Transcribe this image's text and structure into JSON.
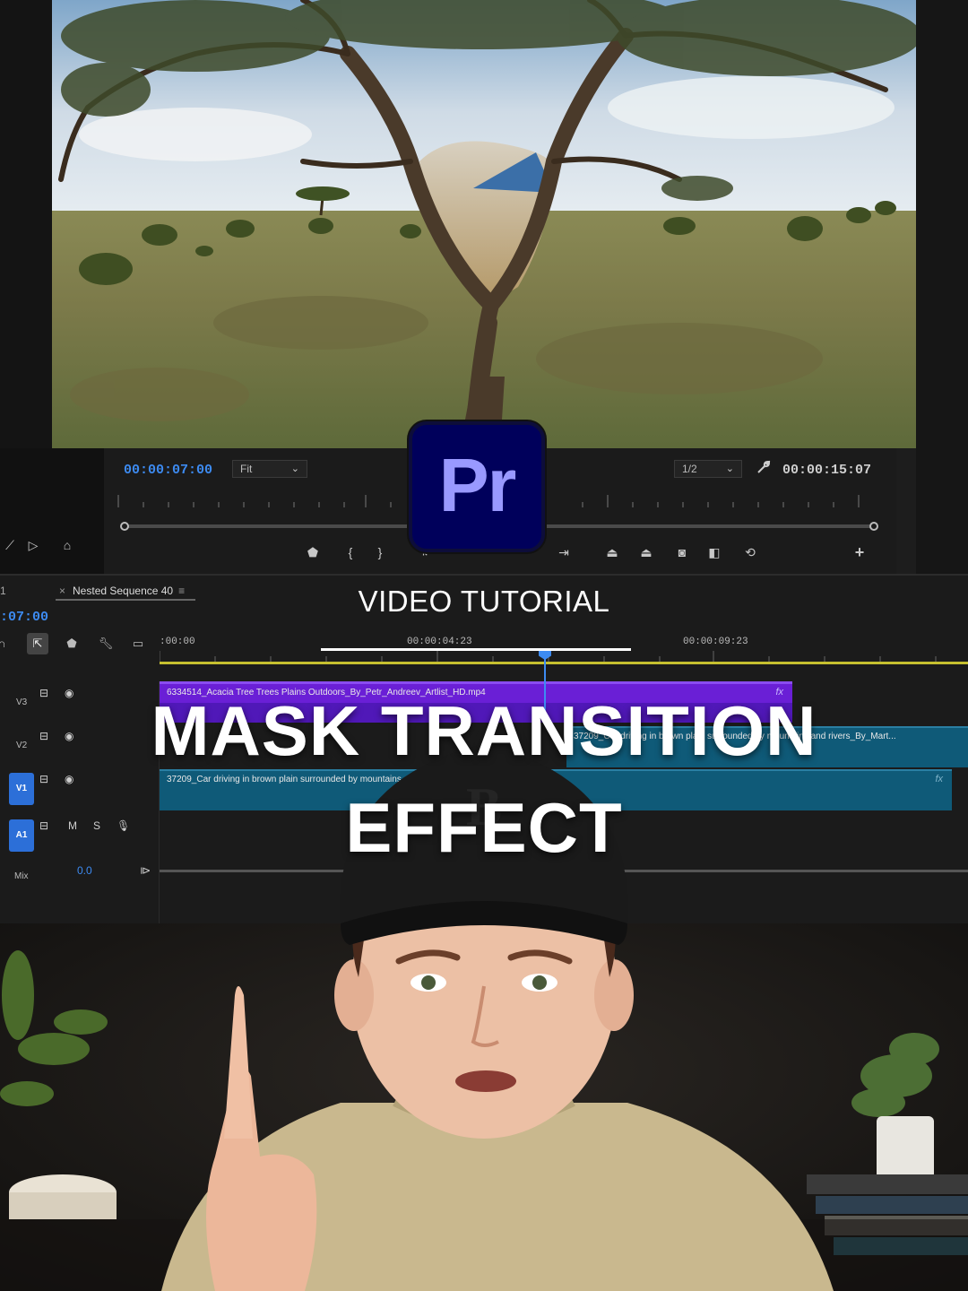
{
  "monitor": {
    "timecode_current": "00:00:07:00",
    "fit_label": "Fit",
    "resolution_label": "1/2",
    "timecode_duration": "00:00:15:07"
  },
  "logo": {
    "text": "Pr",
    "color_bg": "#00005b",
    "color_text": "#9999ff"
  },
  "timeline": {
    "tab_prev": "1",
    "tab_active": "Nested Sequence 40",
    "current_time": ":07:00",
    "ruler_labels": [
      ":00:00",
      "00:00:04:23",
      "00:00:09:23"
    ],
    "tracks": [
      {
        "label": "V3"
      },
      {
        "label": "V2"
      },
      {
        "label": "V1"
      },
      {
        "label": "A1"
      },
      {
        "label": "Mix",
        "value": "0.0"
      }
    ],
    "audio_buttons": {
      "mute": "M",
      "solo": "S"
    },
    "clips": {
      "v3": "6334514_Acacia Tree Trees Plains Outdoors_By_Petr_Andreev_Artlist_HD.mp4",
      "v2": "37209_Car driving in brown plain surrounded by mountains and rivers_By_Mart...",
      "v1": "37209_Car driving in brown plain surrounded by mountains and rivers_By_Martin_Artlist_HD.mp4",
      "fx": "fx"
    },
    "colors": {
      "v3_clip": "#6a1fd6",
      "video_clip": "#0f5a78",
      "work_bar": "#c6c030",
      "playhead": "#3d8bf2"
    }
  },
  "overlay": {
    "subtitle": "VIDEO TUTORIAL",
    "title_line1": "MASK TRANSITION",
    "title_line2": "EFFECT"
  }
}
